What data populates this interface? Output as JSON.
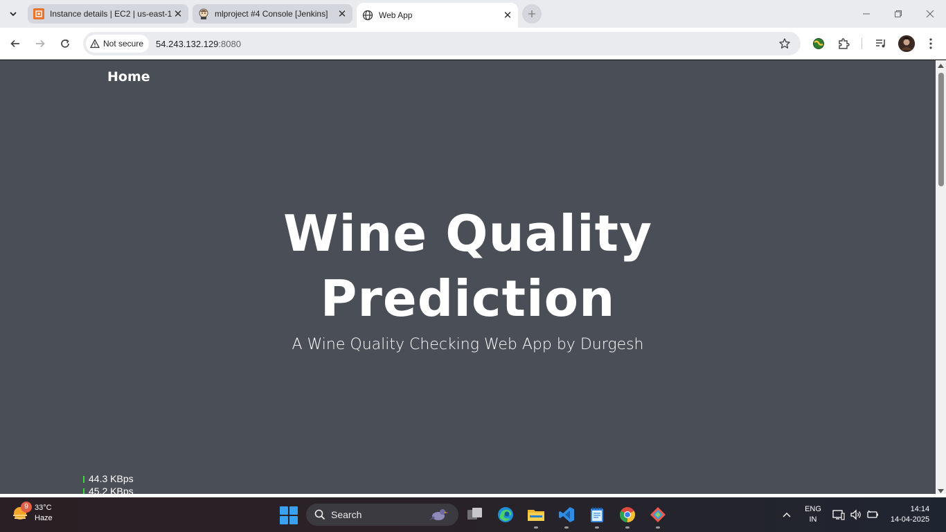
{
  "browser": {
    "tabs": [
      {
        "title": "Instance details | EC2 | us-east-1",
        "favicon": "aws-ec2-icon",
        "active": false
      },
      {
        "title": "mlproject #4 Console [Jenkins]",
        "favicon": "jenkins-icon",
        "active": false
      },
      {
        "title": "Web App",
        "favicon": "globe-icon",
        "active": true
      }
    ],
    "security_label": "Not secure",
    "url_host": "54.243.132.129",
    "url_port": ":8080"
  },
  "page": {
    "nav_home": "Home",
    "title_line1": "Wine Quality",
    "title_line2": "Prediction",
    "subtitle": "A Wine Quality Checking Web App by Durgesh",
    "colors": {
      "background": "#4a4e56",
      "text": "#ffffff"
    }
  },
  "net_monitor": {
    "upload": "44.3 KBps",
    "download": "45.2 KBps"
  },
  "taskbar": {
    "weather_temp": "33°C",
    "weather_desc": "Haze",
    "weather_badge": "9",
    "search_label": "Search",
    "lang_line1": "ENG",
    "lang_line2": "IN",
    "time": "14:14",
    "date": "14-04-2025"
  }
}
